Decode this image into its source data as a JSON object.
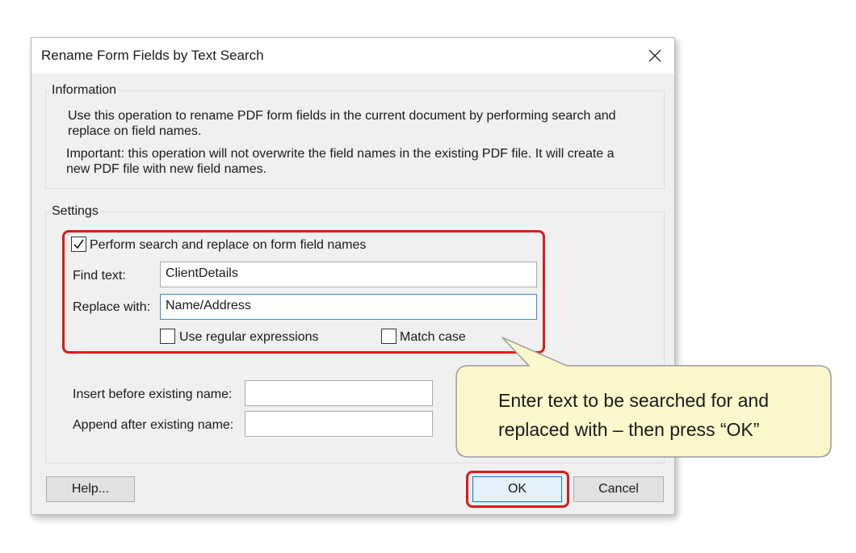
{
  "dialog": {
    "title": "Rename Form Fields by Text Search",
    "close_icon": "close-icon"
  },
  "information": {
    "label": "Information",
    "line1": "Use this operation to rename PDF form fields in the current document by performing search and",
    "line2": "replace on field names.",
    "line3": "Important: this operation will not overwrite the field names in the existing PDF file. It will create a",
    "line4": "new PDF file with new field names."
  },
  "settings": {
    "label": "Settings",
    "perform_checkbox": {
      "label": "Perform search and replace on form field names",
      "checked": true
    },
    "find_label": "Find text:",
    "find_value": "ClientDetails",
    "replace_label": "Replace with:",
    "replace_value": "Name/Address",
    "regex_checkbox": {
      "label": "Use regular expressions",
      "checked": false
    },
    "match_case_checkbox": {
      "label": "Match case",
      "checked": false
    },
    "insert_before_label": "Insert before existing name:",
    "insert_before_value": "",
    "append_after_label": "Append after existing name:",
    "append_after_value": ""
  },
  "buttons": {
    "help": "Help...",
    "ok": "OK",
    "cancel": "Cancel"
  },
  "callout": {
    "line1": "Enter text to be searched for and",
    "line2": "replaced with – then press “OK”",
    "fill": "#fbf8cb",
    "stroke": "#9b9b9b"
  },
  "colors": {
    "highlight": "#e01919",
    "focus_border": "#0078d7",
    "dialog_bg": "#f0f0f0"
  }
}
